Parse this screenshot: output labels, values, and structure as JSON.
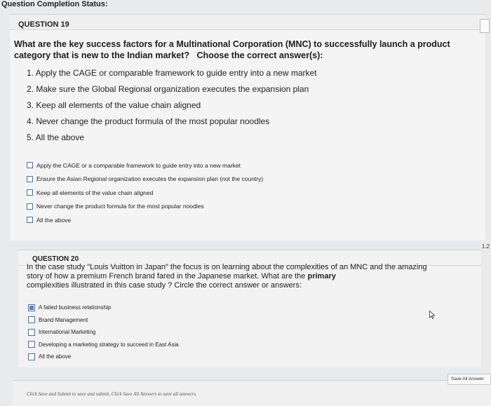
{
  "status": {
    "label": "Question Completion Status:"
  },
  "q19": {
    "header": "QUESTION 19",
    "question_main": "What are the key success factors for a Multinational Corporation (MNC) to successfully launch a product category that is new to the Indian market?",
    "question_instruction": "Choose the correct answer(s):",
    "list": [
      "1. Apply the CAGE or comparable framework to guide entry into a new market",
      "2. Make sure the Global Regional organization executes the expansion plan",
      "3. Keep all elements of the value chain aligned",
      "4. Never change the product formula of the most popular noodles",
      "5. All the above"
    ],
    "options": [
      {
        "label": "Apply the CAGE or a comparable framework to guide entry into a new market",
        "checked": false
      },
      {
        "label": "Ensure the Asian Regional organization executes the expansion plan (not the country)",
        "checked": false
      },
      {
        "label": "Keep all elements of the value chain aligned",
        "checked": false
      },
      {
        "label": "Never change the product formula for the most popular noodles",
        "checked": false
      },
      {
        "label": "All the above",
        "checked": false
      }
    ]
  },
  "points": "1.2",
  "q20": {
    "header": "QUESTION 20",
    "question_part1": "In the case study \"Louis Vuitton in Japan\" the focus is on learning about the complexities of an MNC and the amazing story of how a premium French brand fared in the Japanese market. What are the",
    "question_bold": "primary",
    "question_part2": "complexities illustrated in this case study ? Circle the correct answer or answers:",
    "options": [
      {
        "label": "A failed business relationship",
        "checked": true
      },
      {
        "label": "Brand Management",
        "checked": false
      },
      {
        "label": "International Marketing",
        "checked": false
      },
      {
        "label": "Developing a marketing strategy to succeed in East Asia",
        "checked": false
      },
      {
        "label": "All the above",
        "checked": false
      }
    ]
  },
  "save_all_button": "Save All Answer",
  "footer": "Click Save and Submit to save and submit. Click Save All Answers to save all answers."
}
